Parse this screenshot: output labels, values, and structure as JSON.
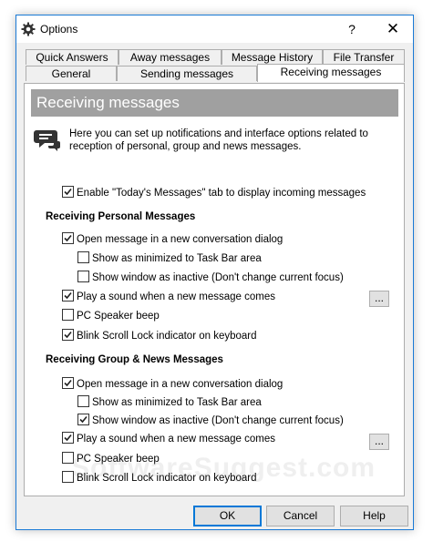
{
  "window": {
    "title": "Options",
    "help_label": "?",
    "close_label": "✕"
  },
  "tabs": {
    "row1": [
      "Quick Answers",
      "Away messages",
      "Message History",
      "File Transfer"
    ],
    "row2": [
      "General",
      "Sending messages",
      "Receiving messages"
    ],
    "active": "Receiving messages"
  },
  "panel": {
    "banner": "Receiving messages",
    "info_icon": "chat-bubble-icon",
    "info_text": "Here you can set up notifications and interface options related to reception of personal, group and news messages.",
    "enable_today": {
      "label": "Enable \"Today's Messages\" tab to display incoming messages",
      "checked": true
    }
  },
  "personal": {
    "heading": "Receiving Personal Messages",
    "open_dialog": {
      "label": "Open message in a new conversation dialog",
      "checked": true
    },
    "minimized": {
      "label": "Show as minimized to Task Bar area",
      "checked": false
    },
    "inactive": {
      "label": "Show window as inactive (Don't change current focus)",
      "checked": false
    },
    "play_sound": {
      "label": "Play a sound when a new message comes",
      "checked": true
    },
    "pc_speaker": {
      "label": "PC Speaker beep",
      "checked": false
    },
    "blink": {
      "label": "Blink Scroll Lock indicator on keyboard",
      "checked": true
    },
    "sound_button": "..."
  },
  "group": {
    "heading": "Receiving Group & News Messages",
    "open_dialog": {
      "label": "Open message in a new conversation dialog",
      "checked": true
    },
    "minimized": {
      "label": "Show as minimized to Task Bar area",
      "checked": false
    },
    "inactive": {
      "label": "Show window as inactive (Don't change current focus)",
      "checked": true
    },
    "play_sound": {
      "label": "Play a sound when a new message comes",
      "checked": true
    },
    "pc_speaker": {
      "label": "PC Speaker beep",
      "checked": false
    },
    "blink": {
      "label": "Blink Scroll Lock indicator on keyboard",
      "checked": false
    },
    "sound_button": "..."
  },
  "buttons": {
    "ok": "OK",
    "cancel": "Cancel",
    "help": "Help"
  },
  "watermark": "SoftwareSuggest.com",
  "colors": {
    "accent": "#0078d7",
    "banner_bg": "#a0a0a0",
    "dialog_bg": "#f0f0f0"
  }
}
